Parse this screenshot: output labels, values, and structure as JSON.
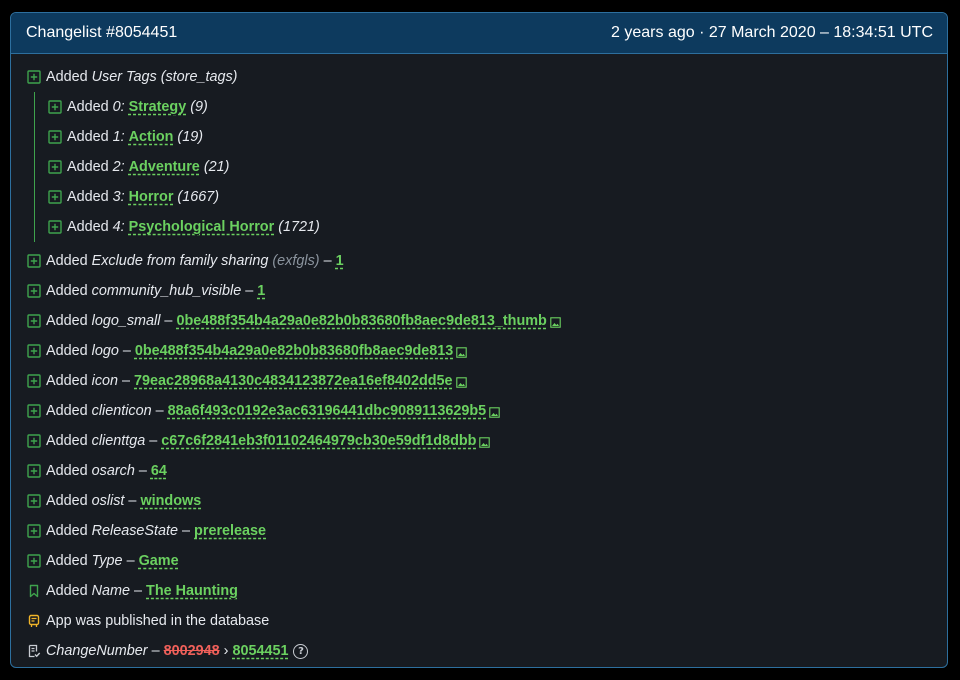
{
  "header": {
    "title": "Changelist #8054451",
    "timestamp": "2 years ago · 27 March 2020 – 18:34:51 UTC"
  },
  "added_word": "Added",
  "sep": "–",
  "tags": {
    "key": "User Tags",
    "key_id": "(store_tags)",
    "items": [
      {
        "index": "0:",
        "name": "Strategy",
        "count": "(9)"
      },
      {
        "index": "1:",
        "name": "Action",
        "count": "(19)"
      },
      {
        "index": "2:",
        "name": "Adventure",
        "count": "(21)"
      },
      {
        "index": "3:",
        "name": "Horror",
        "count": "(1667)"
      },
      {
        "index": "4:",
        "name": "Psychological Horror",
        "count": "(1721)"
      }
    ]
  },
  "rows": [
    {
      "key": "Exclude from family sharing",
      "key_id": "(exfgls)",
      "value": "1"
    },
    {
      "key": "community_hub_visible",
      "value": "1"
    },
    {
      "key": "logo_small",
      "value": "0be488f354b4a29a0e82b0b83680fb8aec9de813_thumb",
      "image": true
    },
    {
      "key": "logo",
      "value": "0be488f354b4a29a0e82b0b83680fb8aec9de813",
      "image": true
    },
    {
      "key": "icon",
      "value": "79eac28968a4130c4834123872ea16ef8402dd5e",
      "image": true
    },
    {
      "key": "clienticon",
      "value": "88a6f493c0192e3ac63196441dbc9089113629b5",
      "image": true
    },
    {
      "key": "clienttga",
      "value": "c67c6f2841eb3f01102464979cb30e59df1d8dbb",
      "image": true
    },
    {
      "key": "osarch",
      "value": "64"
    },
    {
      "key": "oslist",
      "value": "windows"
    },
    {
      "key": "ReleaseState",
      "value": "prerelease"
    },
    {
      "key": "Type",
      "value": "Game"
    }
  ],
  "name_row": {
    "key": "Name",
    "value": "The Haunting"
  },
  "published_text": "App was published in the database",
  "change_number": {
    "key": "ChangeNumber",
    "old": "8002948",
    "arrow": "›",
    "new": "8054451",
    "help": "?"
  },
  "colors": {
    "added": "#3fa34d",
    "value": "#6bd160",
    "removed": "#f0605a",
    "published": "#f0b429",
    "header_bg": "#0d3a5e"
  }
}
